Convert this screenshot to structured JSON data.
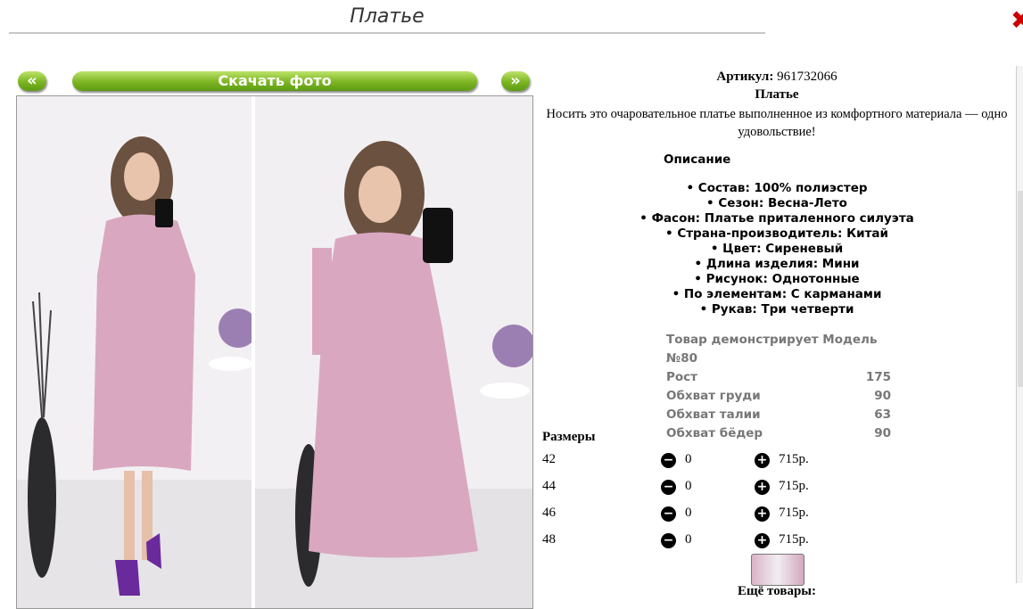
{
  "page": {
    "title": "Платье",
    "close_icon": "close-icon"
  },
  "gallery": {
    "prev_label": "«",
    "next_label": "»",
    "download_label": "Скачать фото",
    "photos": [
      "dress-photo-front",
      "dress-photo-selfie"
    ]
  },
  "product": {
    "article_label": "Артикул:",
    "article_value": "961732066",
    "name": "Платье",
    "tagline": "Носить это очаровательное платье выполненное из комфортного материала — одно удовольствие!",
    "description_title": "Описание",
    "features": [
      "• Состав: 100% полиэстер",
      "• Сезон: Весна-Лето",
      "• Фасон: Платье приталенного силуэта",
      "• Страна-производитель: Китай",
      "• Цвет: Сиреневый",
      "• Длина изделия: Мини",
      "• Рисунок: Однотонные",
      "• По элементам: С карманами",
      "• Рукав: Три четверти"
    ],
    "model": {
      "heading": "Товар демонстрирует Модель №80",
      "rows": [
        {
          "label": "Рост",
          "value": "175"
        },
        {
          "label": "Обхват груди",
          "value": "90"
        },
        {
          "label": "Обхват талии",
          "value": "63"
        },
        {
          "label": "Обхват бёдер",
          "value": "90"
        }
      ]
    }
  },
  "sizes": {
    "heading": "Размеры",
    "rows": [
      {
        "size": "42",
        "qty": "0",
        "price": "715р."
      },
      {
        "size": "44",
        "qty": "0",
        "price": "715р."
      },
      {
        "size": "46",
        "qty": "0",
        "price": "715р."
      },
      {
        "size": "48",
        "qty": "0",
        "price": "715р."
      }
    ],
    "minus_icon": "minus-circle-icon",
    "plus_icon": "plus-circle-icon"
  },
  "more": {
    "heading": "Ещё товары:"
  },
  "colors": {
    "button_green": "#7bb522",
    "close_red": "#cc0000",
    "model_gray": "#777777",
    "dress_pink": "#d9a8c0"
  }
}
